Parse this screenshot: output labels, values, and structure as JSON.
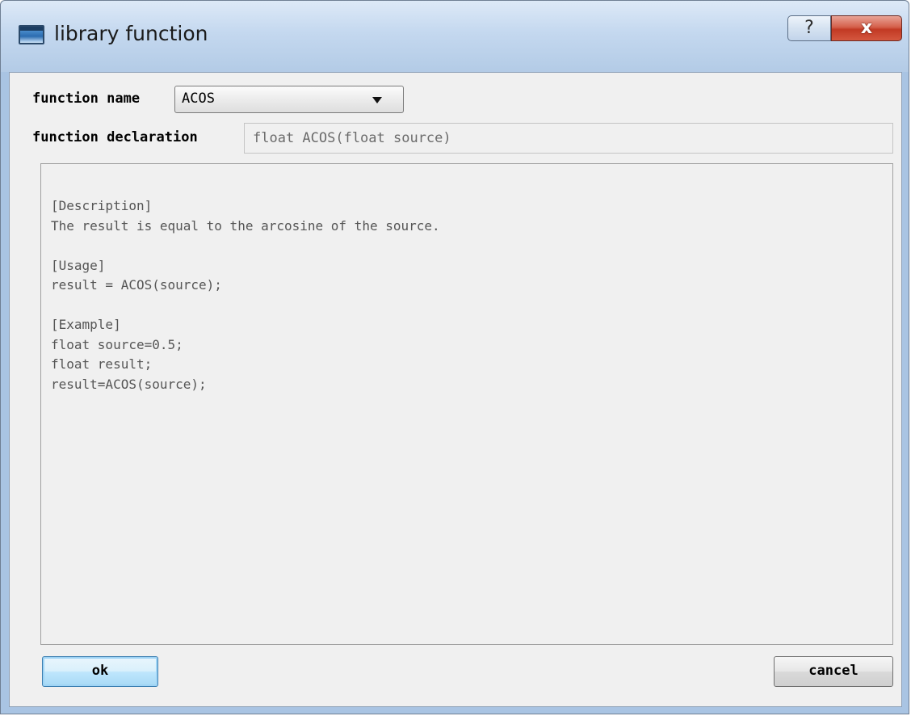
{
  "window": {
    "title": "library function",
    "help_label": "?",
    "close_label": "x"
  },
  "form": {
    "function_name_label": "function name",
    "function_name_value": "ACOS",
    "declaration_label": "function declaration",
    "declaration_value": "float ACOS(float source)"
  },
  "description_text": "[Description]\nThe result is equal to the arcosine of the source.\n\n[Usage]\nresult = ACOS(source);\n\n[Example]\nfloat source=0.5;\nfloat result;\nresult=ACOS(source);",
  "buttons": {
    "ok_label": "ok",
    "cancel_label": "cancel"
  },
  "colors": {
    "close_button": "#c23a24",
    "ok_button_border": "#3c7fb1",
    "client_background": "#f0f0f0"
  },
  "icons": {
    "title": "window-app-icon",
    "help": "help-icon",
    "close": "close-icon",
    "dropdown": "chevron-down-icon"
  }
}
